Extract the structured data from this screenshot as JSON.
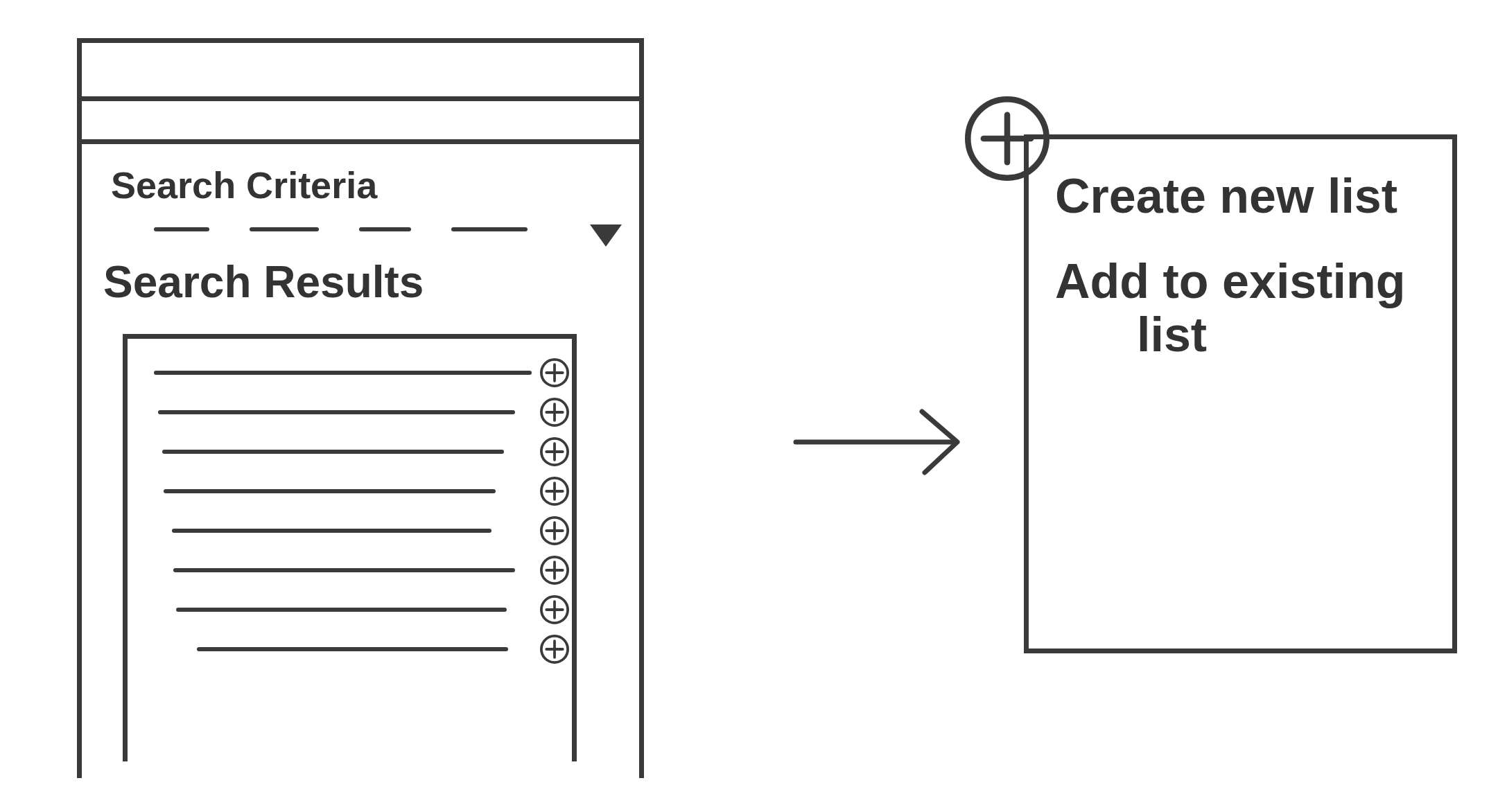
{
  "mobile_screen": {
    "search_criteria": {
      "label": "Search Criteria"
    },
    "search_results": {
      "label": "Search Results",
      "rows": [
        {
          "kind": "placeholder_line"
        },
        {
          "kind": "placeholder_line"
        },
        {
          "kind": "placeholder_line"
        },
        {
          "kind": "placeholder_line"
        },
        {
          "kind": "placeholder_line"
        },
        {
          "kind": "placeholder_line"
        },
        {
          "kind": "placeholder_line"
        },
        {
          "kind": "placeholder_line"
        }
      ]
    }
  },
  "popup_menu": {
    "items": [
      {
        "label": "Create new list"
      },
      {
        "label": "Add to existing list"
      }
    ]
  }
}
